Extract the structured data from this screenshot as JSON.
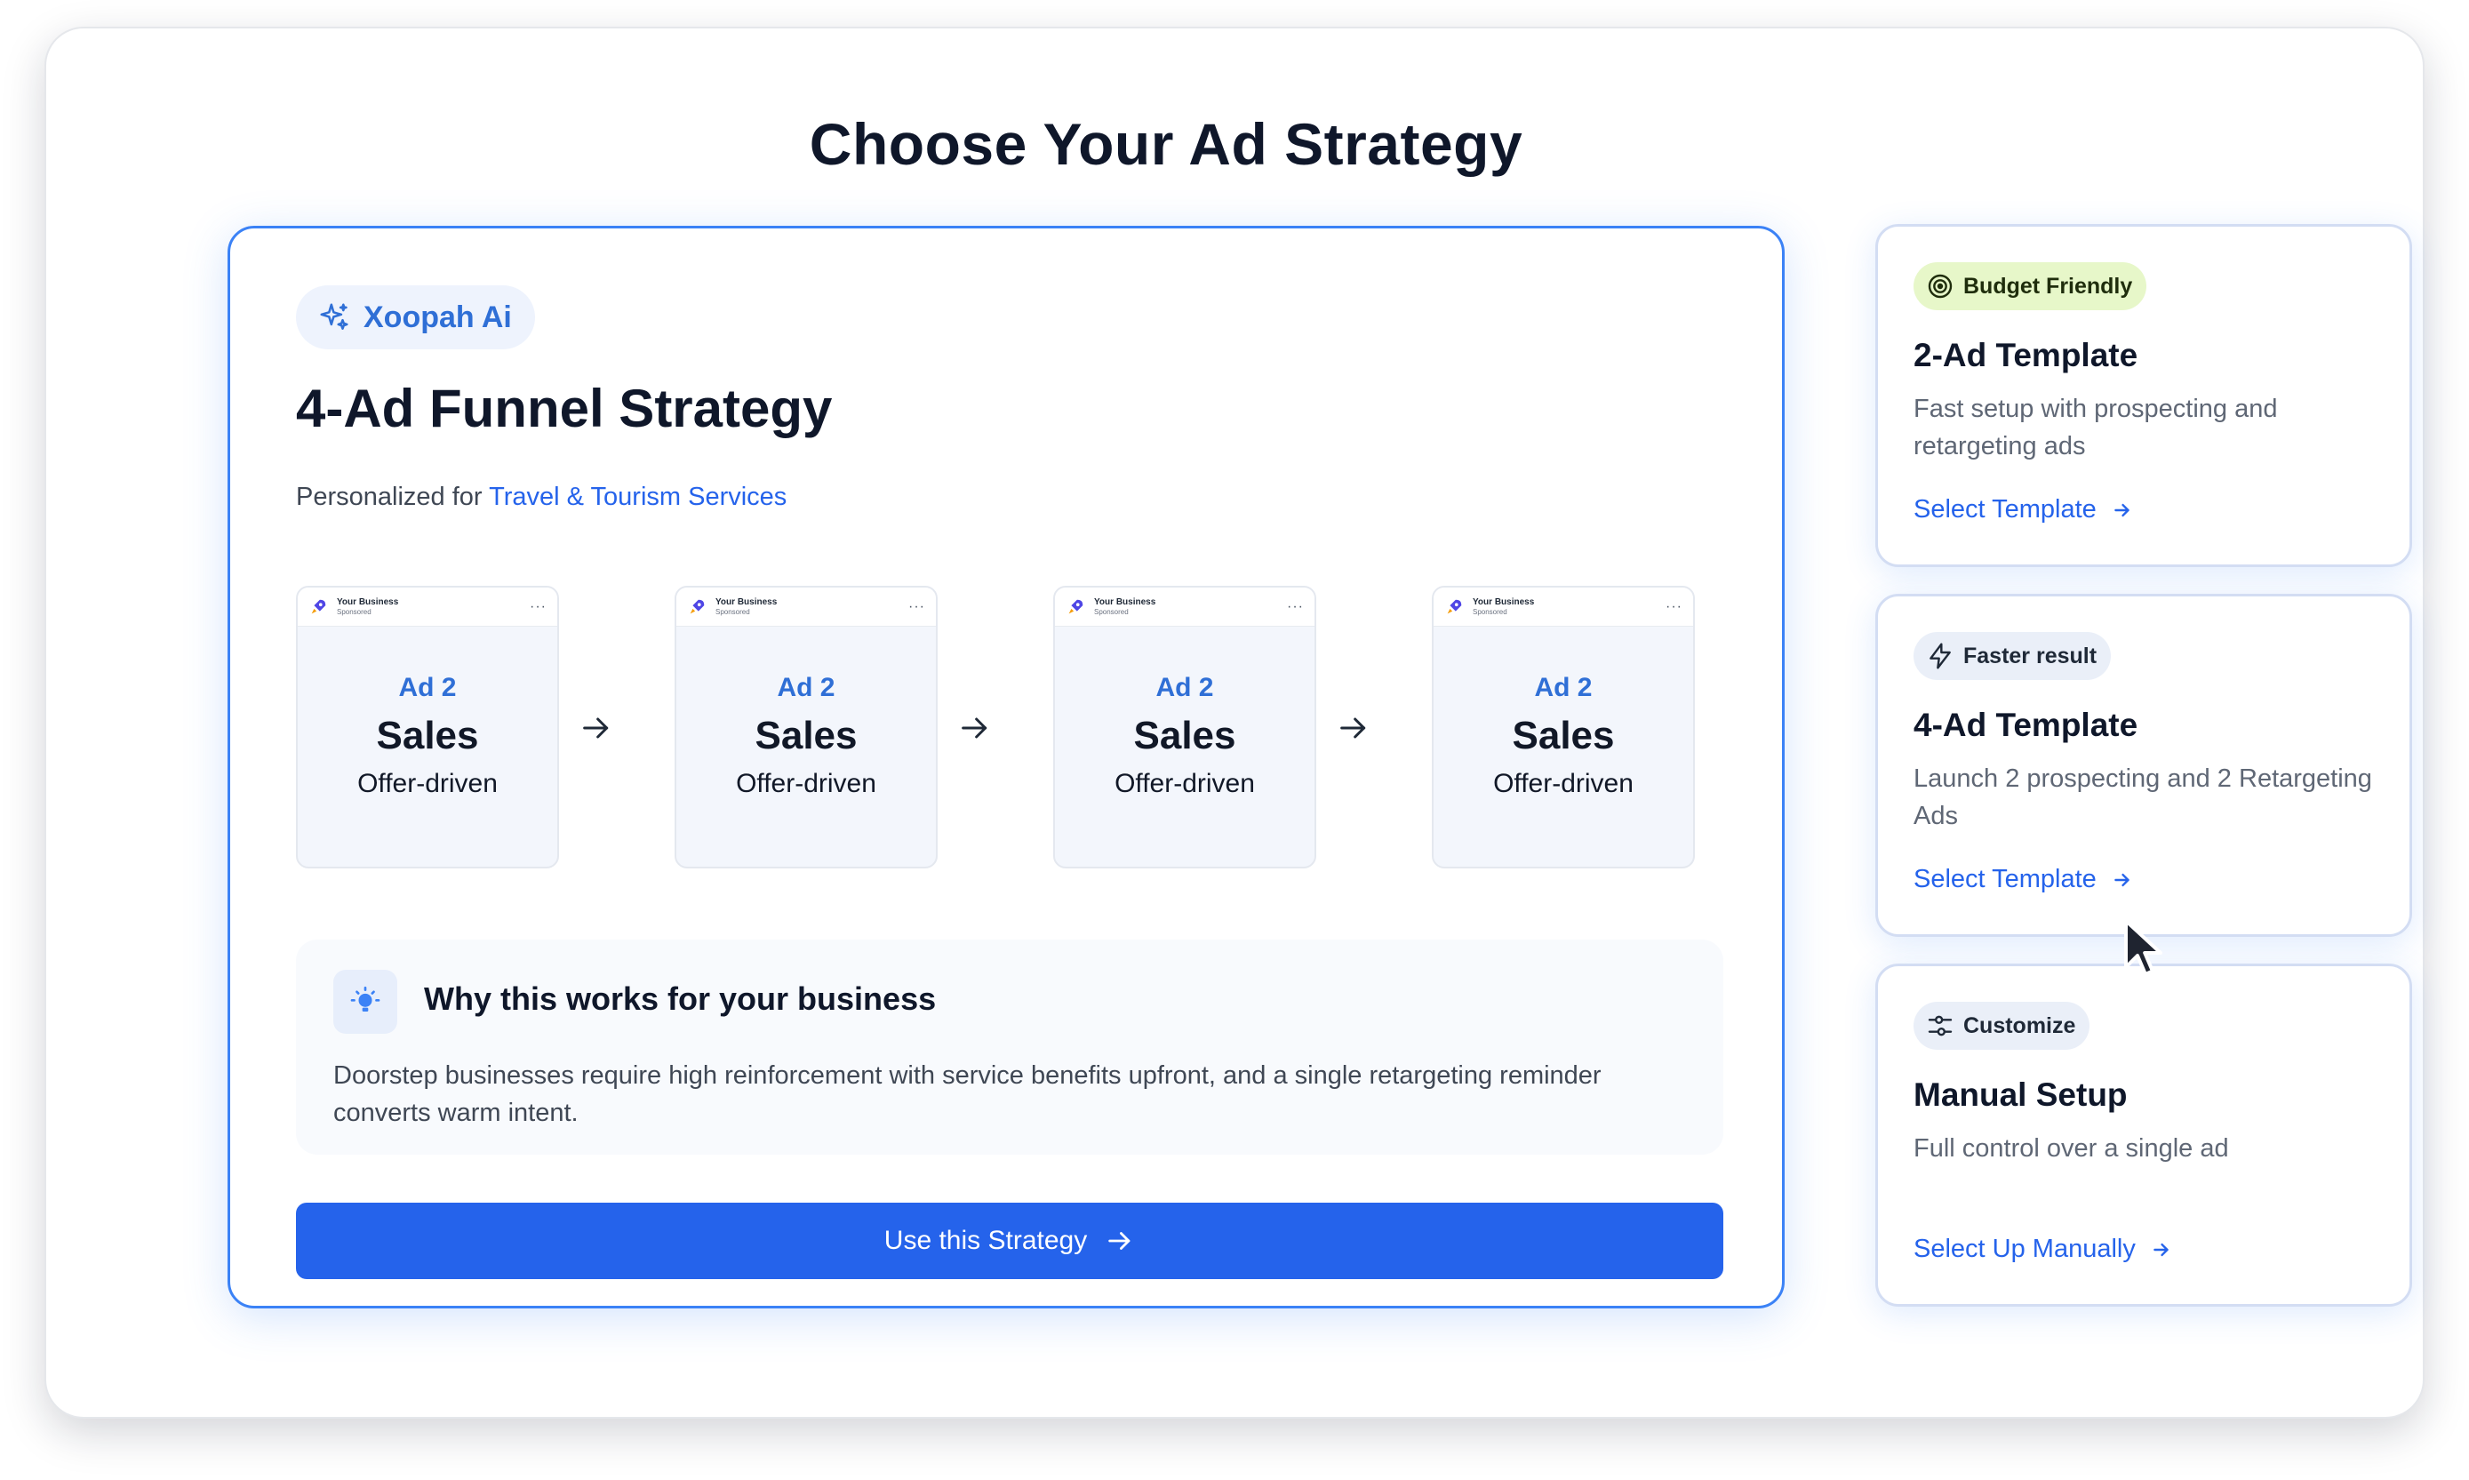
{
  "page": {
    "title": "Choose Your Ad Strategy"
  },
  "main": {
    "badge": "Xoopah Ai",
    "title": "4-Ad Funnel Strategy",
    "personalized_prefix": "Personalized for",
    "industry": "Travel & Tourism Services",
    "ads": [
      {
        "business": "Your Business",
        "sponsored": "Sponsored",
        "label": "Ad 2",
        "type": "Sales",
        "desc": "Offer-driven"
      },
      {
        "business": "Your Business",
        "sponsored": "Sponsored",
        "label": "Ad 2",
        "type": "Sales",
        "desc": "Offer-driven"
      },
      {
        "business": "Your Business",
        "sponsored": "Sponsored",
        "label": "Ad 2",
        "type": "Sales",
        "desc": "Offer-driven"
      },
      {
        "business": "Your Business",
        "sponsored": "Sponsored",
        "label": "Ad 2",
        "type": "Sales",
        "desc": "Offer-driven"
      }
    ],
    "why_title": "Why this works for your business",
    "why_body": "Doorstep businesses require high reinforcement with service benefits upfront, and a single retargeting reminder converts warm intent.",
    "cta_label": "Use this Strategy"
  },
  "options": [
    {
      "tag": "Budget Friendly",
      "tag_icon": "target-icon",
      "title": "2-Ad Template",
      "desc": "Fast setup with prospecting and retargeting ads",
      "link": "Select Template"
    },
    {
      "tag": "Faster result",
      "tag_icon": "lightning-icon",
      "title": "4-Ad Template",
      "desc": "Launch 2 prospecting and 2 Retargeting Ads",
      "link": "Select Template"
    },
    {
      "tag": "Customize",
      "tag_icon": "sliders-icon",
      "title": "Manual Setup",
      "desc": "Full control over a single ad",
      "link": "Select Up Manually"
    }
  ],
  "colors": {
    "accent": "#2563eb",
    "accent_text": "#2f6fd6",
    "budget_tag_bg": "#e7f7c9",
    "neutral_tag_bg": "#eaeff8"
  }
}
